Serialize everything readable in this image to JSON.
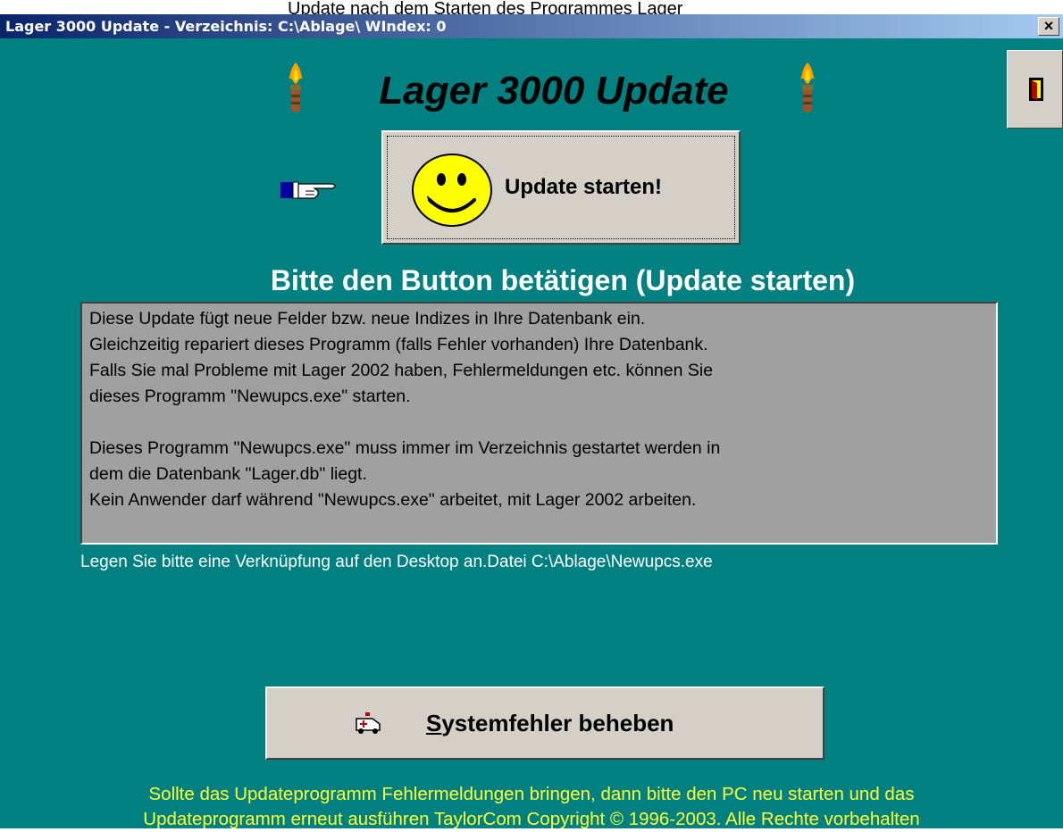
{
  "caption_above": "Update nach dem Starten des Programmes Lager",
  "window": {
    "title": "Lager 3000 Update - Verzeichnis: C:\\Ablage\\   WIndex: 0",
    "close_label": "×"
  },
  "app_title": "Lager 3000 Update",
  "update_button": {
    "label": "Update starten!"
  },
  "headline": "Bitte den Button betätigen (Update starten)",
  "info_lines": [
    "Diese Update fügt neue Felder bzw. neue Indizes in Ihre Datenbank ein.",
    "Gleichzeitig repariert dieses Programm (falls Fehler vorhanden) Ihre Datenbank.",
    "Falls Sie mal Probleme mit Lager 2002 haben, Fehlermeldungen etc. können Sie",
    "dieses Programm \"Newupcs.exe\" starten.",
    "Dieses Programm \"Newupcs.exe\" muss immer im Verzeichnis gestartet werden in",
    "dem die Datenbank \"Lager.db\" liegt.",
    "Kein Anwender darf während  \"Newupcs.exe\" arbeitet, mit Lager 2002 arbeiten."
  ],
  "shortcut_note": "Legen Sie bitte eine Verknüpfung auf den Desktop an.Datei C:\\Ablage\\Newupcs.exe",
  "system_button": {
    "mnemonic": "S",
    "label_rest": "ystemfehler beheben"
  },
  "footer_lines": [
    "Sollte das Updateprogramm Fehlermeldungen bringen, dann bitte den PC neu starten und das",
    "Updateprogramm erneut ausführen TaylorCom Copyright © 1996-2003. Alle Rechte vorbehalten"
  ],
  "icons": {
    "exit": "door-exit-icon",
    "torch": "torch-icon",
    "pointer": "pointing-hand-icon",
    "smiley": "smiley-face-icon",
    "system": "ambulance-icon"
  },
  "colors": {
    "background": "#008080",
    "button_face": "#d4d0c8",
    "info_box": "#a0a0a0",
    "footer_text": "#ffff33",
    "smiley": "#ffff00"
  }
}
